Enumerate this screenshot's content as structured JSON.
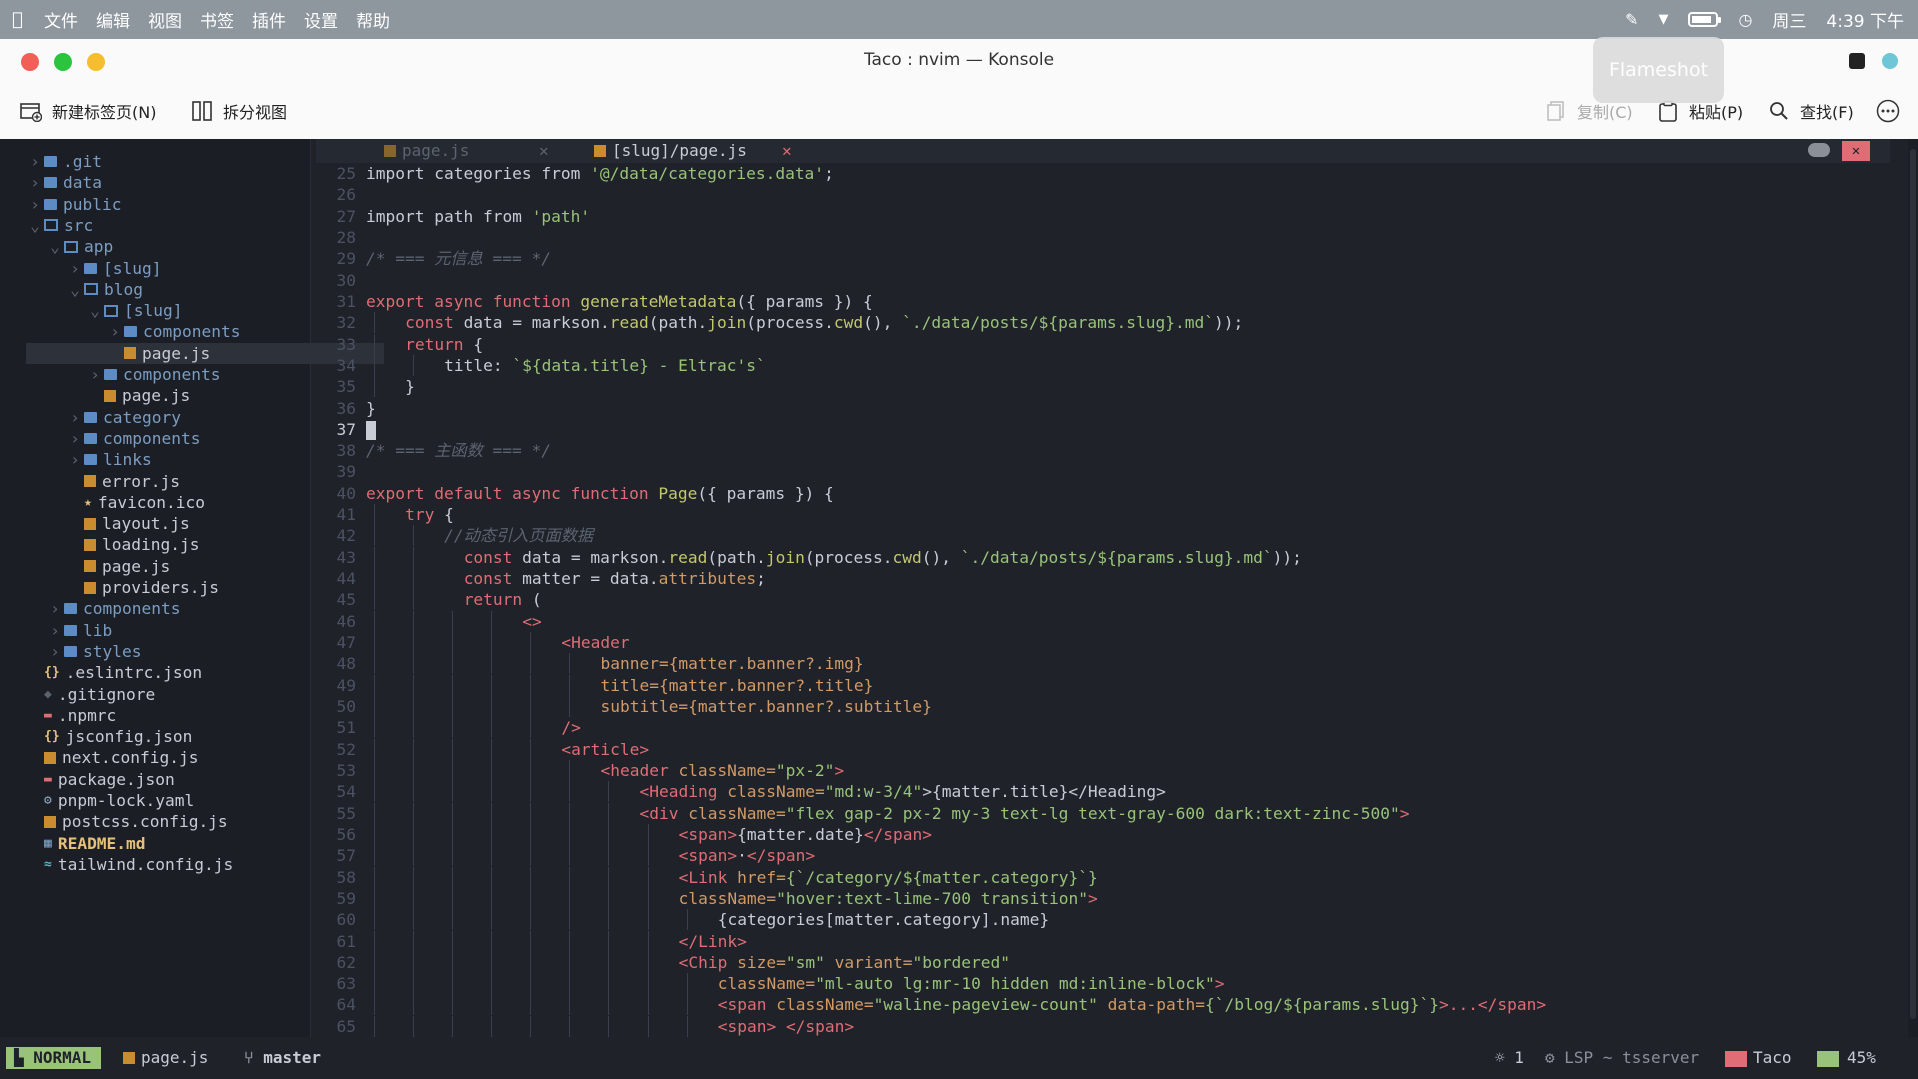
{
  "menubar": {
    "apple_icon": "apple-icon",
    "items": [
      "文件",
      "编辑",
      "视图",
      "书签",
      "插件",
      "设置",
      "帮助"
    ],
    "day": "周三",
    "time": "4:39 下午",
    "battery_level": 0.85
  },
  "window": {
    "title": "Taco : nvim — Konsole",
    "overlay": "Flameshot",
    "colors": {
      "close": "#f15f57",
      "minimize": "#2bc43f",
      "maximize": "#f6be2f",
      "cyan": "#6ec6d6"
    }
  },
  "toolbar": {
    "new_tab": "新建标签页(N)",
    "split_view": "拆分视图",
    "copy": "复制(C)",
    "paste": "粘贴(P)",
    "find": "查找(F)"
  },
  "tabs": [
    {
      "label": "page.js",
      "active": false
    },
    {
      "label": "[slug]/page.js",
      "active": true
    }
  ],
  "tab_close_glyph": "✕",
  "filetree": [
    {
      "chev": "›",
      "icon": "folder",
      "name": ".git",
      "indent": 0
    },
    {
      "chev": "›",
      "icon": "folder",
      "name": "data",
      "indent": 0
    },
    {
      "chev": "›",
      "icon": "folder",
      "name": "public",
      "indent": 0
    },
    {
      "chev": "⌄",
      "icon": "folder-open",
      "name": "src",
      "indent": 0
    },
    {
      "chev": "⌄",
      "icon": "folder-open",
      "name": "app",
      "indent": 1
    },
    {
      "chev": "›",
      "icon": "folder",
      "name": "[slug]",
      "indent": 2
    },
    {
      "chev": "⌄",
      "icon": "folder-open",
      "name": "blog",
      "indent": 2
    },
    {
      "chev": "⌄",
      "icon": "folder-open",
      "name": "[slug]",
      "indent": 3
    },
    {
      "chev": "›",
      "icon": "folder",
      "name": "components",
      "indent": 4
    },
    {
      "chev": "",
      "icon": "js",
      "name": "page.js",
      "indent": 4,
      "selected": true
    },
    {
      "chev": "›",
      "icon": "folder",
      "name": "components",
      "indent": 3
    },
    {
      "chev": "",
      "icon": "js",
      "name": "page.js",
      "indent": 3
    },
    {
      "chev": "›",
      "icon": "folder",
      "name": "category",
      "indent": 2
    },
    {
      "chev": "›",
      "icon": "folder",
      "name": "components",
      "indent": 2
    },
    {
      "chev": "›",
      "icon": "folder",
      "name": "links",
      "indent": 2
    },
    {
      "chev": "",
      "icon": "js",
      "name": "error.js",
      "indent": 2
    },
    {
      "chev": "",
      "icon": "star",
      "name": "favicon.ico",
      "indent": 2
    },
    {
      "chev": "",
      "icon": "js",
      "name": "layout.js",
      "indent": 2
    },
    {
      "chev": "",
      "icon": "js",
      "name": "loading.js",
      "indent": 2
    },
    {
      "chev": "",
      "icon": "js",
      "name": "page.js",
      "indent": 2
    },
    {
      "chev": "",
      "icon": "js",
      "name": "providers.js",
      "indent": 2
    },
    {
      "chev": "›",
      "icon": "folder",
      "name": "components",
      "indent": 1
    },
    {
      "chev": "›",
      "icon": "folder",
      "name": "lib",
      "indent": 1
    },
    {
      "chev": "›",
      "icon": "folder",
      "name": "styles",
      "indent": 1
    },
    {
      "chev": "",
      "icon": "json",
      "name": ".eslintrc.json",
      "indent": 0
    },
    {
      "chev": "",
      "icon": "git",
      "name": ".gitignore",
      "indent": 0
    },
    {
      "chev": "",
      "icon": "npm",
      "name": ".npmrc",
      "indent": 0
    },
    {
      "chev": "",
      "icon": "json",
      "name": "jsconfig.json",
      "indent": 0
    },
    {
      "chev": "",
      "icon": "js",
      "name": "next.config.js",
      "indent": 0
    },
    {
      "chev": "",
      "icon": "npm",
      "name": "package.json",
      "indent": 0
    },
    {
      "chev": "",
      "icon": "gear",
      "name": "pnpm-lock.yaml",
      "indent": 0
    },
    {
      "chev": "",
      "icon": "js",
      "name": "postcss.config.js",
      "indent": 0
    },
    {
      "chev": "",
      "icon": "md",
      "name": "README.md",
      "indent": 0,
      "bold": true
    },
    {
      "chev": "",
      "icon": "tailwind",
      "name": "tailwind.config.js",
      "indent": 0
    }
  ],
  "code": [
    {
      "n": "25",
      "indent": 0,
      "segs": [
        [
          "import categories from ",
          "code"
        ],
        [
          "'@/data/categories.data'",
          "str"
        ],
        [
          ";",
          "code"
        ]
      ]
    },
    {
      "n": "26",
      "indent": 0,
      "segs": []
    },
    {
      "n": "27",
      "indent": 0,
      "segs": [
        [
          "import path from ",
          "code"
        ],
        [
          "'path'",
          "str"
        ]
      ]
    },
    {
      "n": "28",
      "indent": 0,
      "segs": []
    },
    {
      "n": "29",
      "indent": 0,
      "segs": [
        [
          "/* === 元信息 === */",
          "cmt"
        ]
      ]
    },
    {
      "n": "30",
      "indent": 0,
      "segs": []
    },
    {
      "n": "31",
      "indent": 0,
      "segs": [
        [
          "export async function ",
          "kw"
        ],
        [
          "generateMetadata",
          "fn"
        ],
        [
          "({ params }) {",
          "code"
        ]
      ]
    },
    {
      "n": "32",
      "indent": 1,
      "segs": [
        [
          "const ",
          "kw"
        ],
        [
          "data = markson.",
          "code"
        ],
        [
          "read",
          "fn"
        ],
        [
          "(path.",
          "code"
        ],
        [
          "join",
          "fn"
        ],
        [
          "(process.",
          "code"
        ],
        [
          "cwd",
          "fn"
        ],
        [
          "(), ",
          "code"
        ],
        [
          "`./data/posts/${params.slug}.md`",
          "str"
        ],
        [
          "));",
          "code"
        ]
      ]
    },
    {
      "n": "33",
      "indent": 1,
      "segs": [
        [
          "return ",
          "kw"
        ],
        [
          "{",
          "code"
        ]
      ]
    },
    {
      "n": "34",
      "indent": 2,
      "segs": [
        [
          "title: ",
          "code"
        ],
        [
          "`${data.title} - Eltrac's`",
          "str"
        ]
      ]
    },
    {
      "n": "35",
      "indent": 1,
      "segs": [
        [
          "}",
          "code"
        ]
      ]
    },
    {
      "n": "36",
      "indent": 0,
      "segs": [
        [
          "}",
          "code"
        ]
      ]
    },
    {
      "n": "37",
      "indent": 0,
      "segs": [],
      "cursor": true
    },
    {
      "n": "38",
      "indent": 0,
      "segs": [
        [
          "/* === 主函数 === */",
          "cmt"
        ]
      ]
    },
    {
      "n": "39",
      "indent": 0,
      "segs": []
    },
    {
      "n": "40",
      "indent": 0,
      "segs": [
        [
          "export default async function ",
          "kw"
        ],
        [
          "Page",
          "fn"
        ],
        [
          "({ params }) {",
          "code"
        ]
      ]
    },
    {
      "n": "41",
      "indent": 1,
      "segs": [
        [
          "try ",
          "kw"
        ],
        [
          "{",
          "code"
        ]
      ]
    },
    {
      "n": "42",
      "indent": 2,
      "segs": [
        [
          "//动态引入页面数据",
          "cmt"
        ]
      ]
    },
    {
      "n": "43",
      "indent": 2.5,
      "segs": [
        [
          "const ",
          "kw"
        ],
        [
          "data = markson.",
          "code"
        ],
        [
          "read",
          "fn"
        ],
        [
          "(path.",
          "code"
        ],
        [
          "join",
          "fn"
        ],
        [
          "(process.",
          "code"
        ],
        [
          "cwd",
          "fn"
        ],
        [
          "(), ",
          "code"
        ],
        [
          "`./data/posts/${params.slug}.md`",
          "str"
        ],
        [
          "));",
          "code"
        ]
      ]
    },
    {
      "n": "44",
      "indent": 2.5,
      "segs": [
        [
          "const ",
          "kw"
        ],
        [
          "matter = data.",
          "code"
        ],
        [
          "attributes",
          "attr"
        ],
        [
          ";",
          "code"
        ]
      ]
    },
    {
      "n": "45",
      "indent": 2.5,
      "segs": [
        [
          "return ",
          "kw"
        ],
        [
          "(",
          "code"
        ]
      ]
    },
    {
      "n": "46",
      "indent": 4,
      "segs": [
        [
          "<>",
          "tag"
        ]
      ]
    },
    {
      "n": "47",
      "indent": 5,
      "segs": [
        [
          "<Header",
          "tag"
        ]
      ]
    },
    {
      "n": "48",
      "indent": 6,
      "segs": [
        [
          "banner={matter.banner?.img}",
          "attr"
        ]
      ]
    },
    {
      "n": "49",
      "indent": 6,
      "segs": [
        [
          "title={matter.banner?.title}",
          "attr"
        ]
      ]
    },
    {
      "n": "50",
      "indent": 6,
      "segs": [
        [
          "subtitle={matter.banner?.subtitle}",
          "attr"
        ]
      ]
    },
    {
      "n": "51",
      "indent": 5,
      "segs": [
        [
          "/>",
          "tag"
        ]
      ]
    },
    {
      "n": "52",
      "indent": 5,
      "segs": [
        [
          "<article>",
          "tag"
        ]
      ]
    },
    {
      "n": "53",
      "indent": 6,
      "segs": [
        [
          "<header ",
          "tag"
        ],
        [
          "className=",
          "attr"
        ],
        [
          "\"px-2\"",
          "str"
        ],
        [
          ">",
          "tag"
        ]
      ]
    },
    {
      "n": "54",
      "indent": 7,
      "segs": [
        [
          "<Heading ",
          "tag"
        ],
        [
          "className=",
          "attr"
        ],
        [
          "\"md:w-3/4\"",
          "str"
        ],
        [
          ">{matter.title}</Heading>",
          "code"
        ]
      ]
    },
    {
      "n": "55",
      "indent": 7,
      "segs": [
        [
          "<div ",
          "tag"
        ],
        [
          "className=",
          "attr"
        ],
        [
          "\"flex gap-2 px-2 my-3 text-lg text-gray-600 dark:text-zinc-500\"",
          "str"
        ],
        [
          ">",
          "tag"
        ]
      ]
    },
    {
      "n": "56",
      "indent": 8,
      "segs": [
        [
          "<span>",
          "tag"
        ],
        [
          "{matter.date}",
          "code"
        ],
        [
          "</span>",
          "tag"
        ]
      ]
    },
    {
      "n": "57",
      "indent": 8,
      "segs": [
        [
          "<span>",
          "tag"
        ],
        [
          "·",
          "code"
        ],
        [
          "</span>",
          "tag"
        ]
      ]
    },
    {
      "n": "58",
      "indent": 8,
      "segs": [
        [
          "<Link ",
          "tag"
        ],
        [
          "href=",
          "attr"
        ],
        [
          "{`/category/${matter.category}`}",
          "str"
        ]
      ]
    },
    {
      "n": "59",
      "indent": 8,
      "segs": [
        [
          "className=",
          "attr"
        ],
        [
          "\"hover:text-lime-700 transition\"",
          "str"
        ],
        [
          ">",
          "tag"
        ]
      ]
    },
    {
      "n": "60",
      "indent": 9,
      "segs": [
        [
          "{categories[matter.category].name}",
          "code"
        ]
      ]
    },
    {
      "n": "61",
      "indent": 8,
      "segs": [
        [
          "</Link>",
          "tag"
        ]
      ]
    },
    {
      "n": "62",
      "indent": 8,
      "segs": [
        [
          "<Chip ",
          "tag"
        ],
        [
          "size=",
          "attr"
        ],
        [
          "\"sm\" ",
          "str"
        ],
        [
          "variant=",
          "attr"
        ],
        [
          "\"bordered\"",
          "str"
        ]
      ]
    },
    {
      "n": "63",
      "indent": 9,
      "segs": [
        [
          "className=",
          "attr"
        ],
        [
          "\"ml-auto lg:mr-10 hidden md:inline-block\"",
          "str"
        ],
        [
          ">",
          "tag"
        ]
      ]
    },
    {
      "n": "64",
      "indent": 9,
      "segs": [
        [
          "<span ",
          "tag"
        ],
        [
          "className=",
          "attr"
        ],
        [
          "\"waline-pageview-count\" ",
          "str"
        ],
        [
          "data-path=",
          "attr"
        ],
        [
          "{`/blog/${params.slug}`}",
          "str"
        ],
        [
          ">...</span>",
          "tag"
        ]
      ]
    },
    {
      "n": "65",
      "indent": 9,
      "segs": [
        [
          "<span> </span>",
          "tag"
        ]
      ]
    }
  ],
  "status": {
    "mode": "NORMAL",
    "file": "page.js",
    "branch": "master",
    "diagnostics": "1",
    "lsp": "LSP ~ tsserver",
    "project": "Taco",
    "percent": "45%"
  }
}
